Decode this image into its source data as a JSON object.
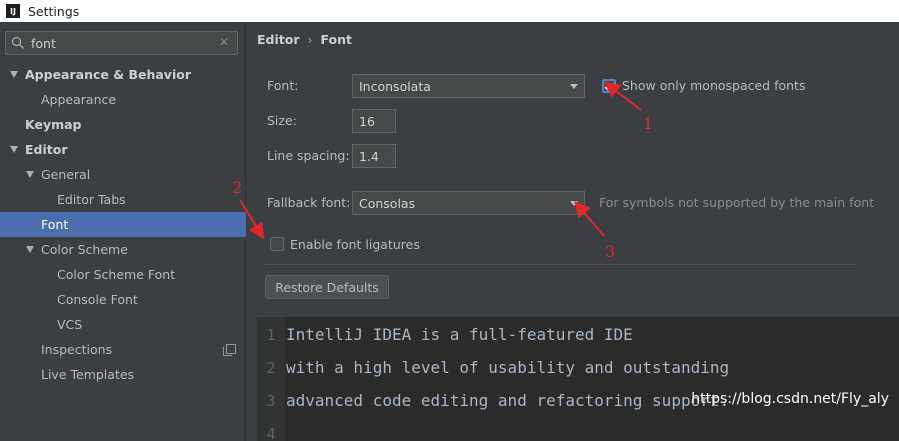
{
  "window": {
    "title": "Settings",
    "app_icon_text": "IJ"
  },
  "search": {
    "value": "font",
    "placeholder": ""
  },
  "tree": [
    {
      "label": "Appearance & Behavior",
      "level": 0,
      "expanded": true,
      "bold": true
    },
    {
      "label": "Appearance",
      "level": 1
    },
    {
      "label": "Keymap",
      "level": 0,
      "bold": true
    },
    {
      "label": "Editor",
      "level": 0,
      "expanded": true,
      "bold": true
    },
    {
      "label": "General",
      "level": 1,
      "expanded": true
    },
    {
      "label": "Editor Tabs",
      "level": 2
    },
    {
      "label": "Font",
      "level": 1,
      "selected": true
    },
    {
      "label": "Color Scheme",
      "level": 1,
      "expanded": true
    },
    {
      "label": "Color Scheme Font",
      "level": 2
    },
    {
      "label": "Console Font",
      "level": 2
    },
    {
      "label": "VCS",
      "level": 2
    },
    {
      "label": "Inspections",
      "level": 1,
      "icon": "copy-icon"
    },
    {
      "label": "Live Templates",
      "level": 1
    }
  ],
  "breadcrumb": {
    "parent": "Editor",
    "separator": "›",
    "current": "Font"
  },
  "form": {
    "font_label": "Font:",
    "font_value": "Inconsolata",
    "monospace_label": "Show only monospaced fonts",
    "monospace_checked": true,
    "size_label": "Size:",
    "size_value": "16",
    "spacing_label": "Line spacing:",
    "spacing_value": "1.4",
    "fallback_label": "Fallback font:",
    "fallback_value": "Consolas",
    "fallback_hint": "For symbols not supported by the main font",
    "ligatures_label": "Enable font ligatures",
    "ligatures_checked": false,
    "restore_button": "Restore Defaults"
  },
  "preview": {
    "lines": [
      {
        "num": "1",
        "text": "IntelliJ IDEA is a full-featured IDE"
      },
      {
        "num": "2",
        "text": "with a high level of usability and outstanding"
      },
      {
        "num": "3",
        "text": "advanced code editing and refactoring support."
      },
      {
        "num": "4",
        "text": ""
      }
    ]
  },
  "annotations": {
    "one": "1",
    "two": "2",
    "three": "3"
  },
  "watermark": "https://blog.csdn.net/Fly_aly",
  "colors": {
    "accent": "#4b6eaf",
    "annotation": "#e0282a",
    "background": "#3c3f41",
    "editor_bg": "#2b2b2b"
  }
}
